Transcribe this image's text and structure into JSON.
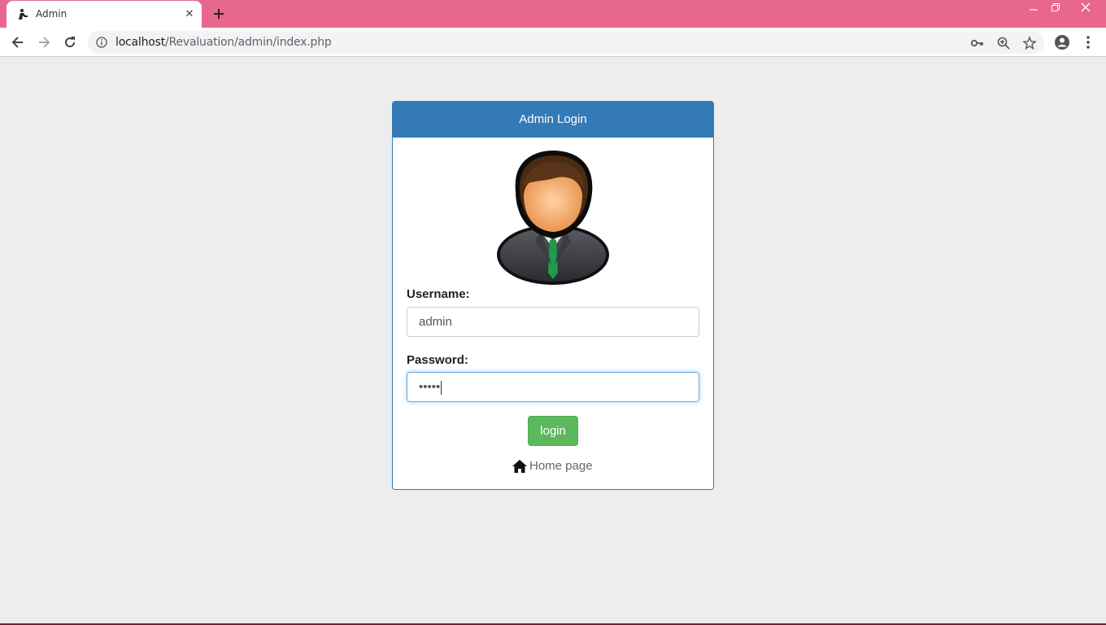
{
  "browser": {
    "tab_title": "Admin",
    "tab_close_icon": "close-icon",
    "url_host": "localhost",
    "url_path": "/Revaluation/admin/index.php",
    "colors": {
      "tabbar": "#e8678e"
    }
  },
  "login": {
    "heading": "Admin Login",
    "username_label": "Username:",
    "username_value": "admin",
    "password_label": "Password:",
    "password_value": "•••••",
    "button_label": "login",
    "home_link": "Home page",
    "colors": {
      "heading_bg": "#337ab7",
      "button_bg": "#5cb85c"
    }
  }
}
